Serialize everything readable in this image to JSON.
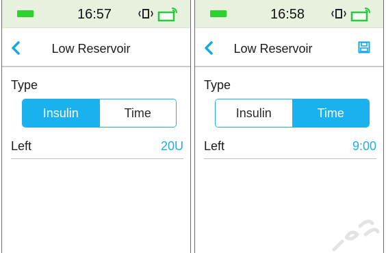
{
  "screens": [
    {
      "status": {
        "time": "16:57"
      },
      "title": "Low Reservoir",
      "type_label": "Type",
      "segment": {
        "options": [
          "Insulin",
          "Time"
        ],
        "selected": "Insulin"
      },
      "left_row": {
        "label": "Left",
        "value": "20U"
      }
    },
    {
      "status": {
        "time": "16:58"
      },
      "title": "Low Reservoir",
      "type_label": "Type",
      "segment": {
        "options": [
          "Insulin",
          "Time"
        ],
        "selected": "Time"
      },
      "left_row": {
        "label": "Left",
        "value": "9:00"
      }
    }
  ],
  "icons": {
    "back": "chevron-left-icon",
    "save": "save-icon",
    "vibrate": "vibrate-icon",
    "battery": "battery-icon",
    "signal": "signal-icon"
  },
  "colors": {
    "accent": "#19b2ef",
    "status_bar_bg": "#e7f1de",
    "battery_green": "#2fd12f",
    "value_text": "#1aaee8"
  }
}
